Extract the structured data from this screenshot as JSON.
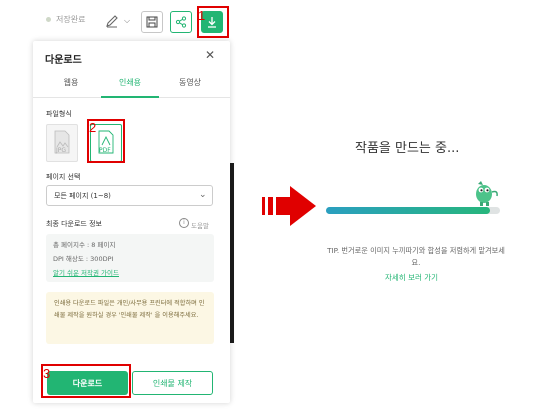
{
  "toolbar": {
    "autosave_label": "저장완료",
    "download_icon": "download-icon",
    "save_icon": "save-icon",
    "share_icon": "share-icon",
    "pen_icon": "pen-icon"
  },
  "annotations": {
    "step1": "1",
    "step2": "2",
    "step3": "3"
  },
  "panel": {
    "title": "다운로드",
    "close": "✕",
    "tabs": [
      {
        "label": "웹용",
        "active": false
      },
      {
        "label": "인쇄용",
        "active": true
      },
      {
        "label": "동영상",
        "active": false
      }
    ],
    "file_format_label": "파일형식",
    "formats": [
      {
        "label": "JPG",
        "selected": false
      },
      {
        "label": "PDF",
        "selected": true
      }
    ],
    "page_select_label": "페이지 선택",
    "page_select_value": "모든 페이지 (1~8)",
    "final_info_label": "최종 다운로드 정보",
    "help_label": "도움말",
    "info": {
      "total_pages": "총 페이지수 : 8 페이지",
      "resolution": "DPI 해상도 : 300DPI",
      "guide_link": "알기 쉬운 저작권 가이드"
    },
    "note": "인쇄용 다운로드 파일은 개인/사무용 프린터에 적합하며 인쇄물 제작을 원하실 경우 '인쇄물 제작' 을 이용해주세요.",
    "download_button": "다운로드",
    "print_button": "인쇄물 제작"
  },
  "progress": {
    "title": "작품을 만드는 중...",
    "value": 0.94,
    "tip": "TIP. 번거로운 이미지 누끼따기와 합성을 저렴하게 맡겨보세요.",
    "more_link": "자세히 보러 가기"
  },
  "colors": {
    "accent": "#22b573",
    "annotation": "#e00000"
  }
}
